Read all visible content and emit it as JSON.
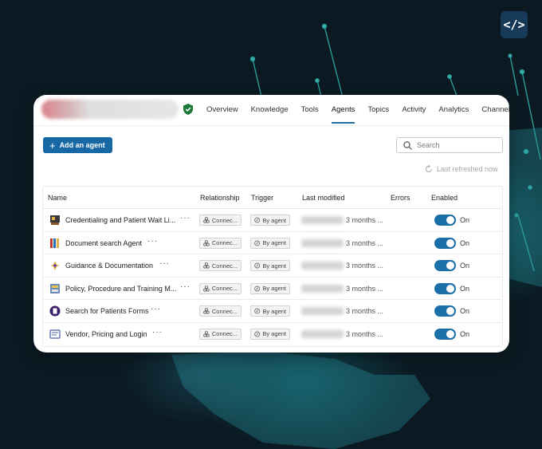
{
  "app": {
    "code_badge": "</>",
    "accent_color": "#1868a6"
  },
  "nav": {
    "items": [
      {
        "label": "Overview",
        "active": false
      },
      {
        "label": "Knowledge",
        "active": false
      },
      {
        "label": "Tools",
        "active": false
      },
      {
        "label": "Agents",
        "active": true
      },
      {
        "label": "Topics",
        "active": false
      },
      {
        "label": "Activity",
        "active": false
      },
      {
        "label": "Analytics",
        "active": false
      },
      {
        "label": "Channels",
        "active": false
      }
    ]
  },
  "toolbar": {
    "add_agent_label": "Add an agent",
    "search_placeholder": "Search",
    "refresh_label": "Last refreshed now"
  },
  "table": {
    "columns": {
      "name": "Name",
      "relationship": "Relationship",
      "trigger": "Trigger",
      "last_modified": "Last modified",
      "errors": "Errors",
      "enabled": "Enabled"
    },
    "rows": [
      {
        "name": "Credentialing and Patient Wait Li...",
        "icon": "credentialing-icon",
        "relationship": "Connec...",
        "trigger": "By agent",
        "modified": "3 months ...",
        "errors": "",
        "enabled": "On"
      },
      {
        "name": "Document search Agent",
        "icon": "document-search-icon",
        "relationship": "Connec...",
        "trigger": "By agent",
        "modified": "3 months ...",
        "errors": "",
        "enabled": "On"
      },
      {
        "name": "Guidance & Documentation",
        "icon": "guidance-icon",
        "relationship": "Connec...",
        "trigger": "By agent",
        "modified": "3 months ...",
        "errors": "",
        "enabled": "On"
      },
      {
        "name": "Policy, Procedure and Training M...",
        "icon": "policy-icon",
        "relationship": "Connec...",
        "trigger": "By agent",
        "modified": "3 months ...",
        "errors": "",
        "enabled": "On"
      },
      {
        "name": "Search for Patients Forms",
        "icon": "patient-forms-icon",
        "relationship": "Connec...",
        "trigger": "By agent",
        "modified": "3 months ...",
        "errors": "",
        "enabled": "On"
      },
      {
        "name": "Vendor, Pricing and Login",
        "icon": "vendor-icon",
        "relationship": "Connec...",
        "trigger": "By agent",
        "modified": "3 months ...",
        "errors": "",
        "enabled": "On"
      }
    ]
  }
}
